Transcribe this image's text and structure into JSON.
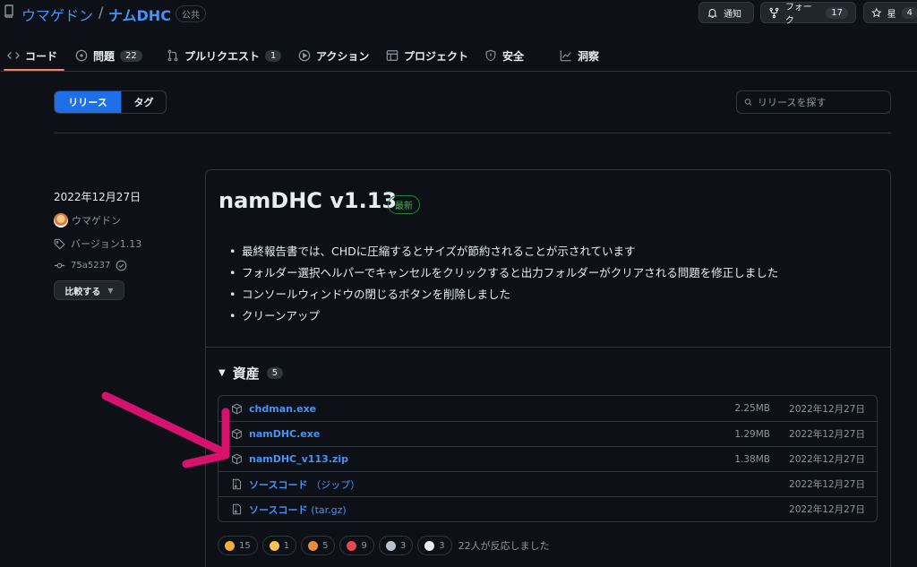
{
  "repo": {
    "owner": "ウマゲドン",
    "separator": "/",
    "name": "ナムDHC",
    "visibility": "公共"
  },
  "header_buttons": {
    "watch": {
      "label": "通知",
      "icon": "bell-icon"
    },
    "fork": {
      "label": "フォーク",
      "count": "17",
      "icon": "fork-icon"
    },
    "star": {
      "label": "星",
      "count": "4",
      "icon": "star-icon"
    }
  },
  "tabs": [
    {
      "label": "コード",
      "icon": "code-icon",
      "active": true
    },
    {
      "label": "問題",
      "count": "22",
      "icon": "issue-icon"
    },
    {
      "label": "プルリクエスト",
      "count": "1",
      "icon": "pull-request-icon"
    },
    {
      "label": "アクション",
      "icon": "play-icon"
    },
    {
      "label": "プロジェクト",
      "icon": "table-icon"
    },
    {
      "label": "安全",
      "icon": "shield-icon"
    },
    {
      "label": "洞察",
      "icon": "graph-icon"
    }
  ],
  "release_toggle": {
    "releases": "リリース",
    "tags": "タグ"
  },
  "search": {
    "placeholder": "リリースを探す"
  },
  "release": {
    "date": "2022年12月27日",
    "author": "ウマゲドン",
    "tag": "バージョン1.13",
    "commit": "75a5237",
    "compare_label": "比較する",
    "title": "namDHC v1.13",
    "latest_badge": "最新",
    "notes": [
      "最終報告書では、CHDに圧縮するとサイズが節約されることが示されています",
      "フォルダー選択ヘルパーでキャンセルをクリックすると出力フォルダーがクリアされる問題を修正しました",
      "コンソールウィンドウの閉じるボタンを削除しました",
      "クリーンアップ"
    ],
    "assets": {
      "label": "資産",
      "count": "5",
      "items": [
        {
          "name": "chdman.exe",
          "size": "2.25MB",
          "date": "2022年12月27日",
          "icon": "package-icon"
        },
        {
          "name": "namDHC.exe",
          "size": "1.29MB",
          "date": "2022年12月27日",
          "icon": "package-icon"
        },
        {
          "name": "namDHC_v113.zip",
          "size": "1.38MB",
          "date": "2022年12月27日",
          "icon": "package-icon"
        },
        {
          "name": "ソースコード",
          "suffix": "（ジップ）",
          "size": "",
          "date": "2022年12月27日",
          "icon": "zip-file-icon"
        },
        {
          "name": "ソースコード",
          "suffix": "(tar.gz)",
          "size": "",
          "date": "2022年12月27日",
          "icon": "zip-file-icon"
        }
      ]
    },
    "reactions": [
      {
        "emoji": "thumbs-up-icon",
        "count": "15",
        "color": "#f2b13d"
      },
      {
        "emoji": "laugh-icon",
        "count": "1",
        "color": "#f6c74a"
      },
      {
        "emoji": "tada-icon",
        "count": "5",
        "color": "#e98b3a"
      },
      {
        "emoji": "heart-icon",
        "count": "9",
        "color": "#e5484d"
      },
      {
        "emoji": "rocket-icon",
        "count": "3",
        "color": "#b9c2cc"
      },
      {
        "emoji": "eyes-icon",
        "count": "3",
        "color": "#e6edf3"
      }
    ],
    "reaction_summary": "22人が反応しました"
  },
  "colors": {
    "accent": "#1f6feb",
    "link": "#4493f8",
    "success": "#3fb950",
    "annotation_arrow": "#d6126d"
  }
}
